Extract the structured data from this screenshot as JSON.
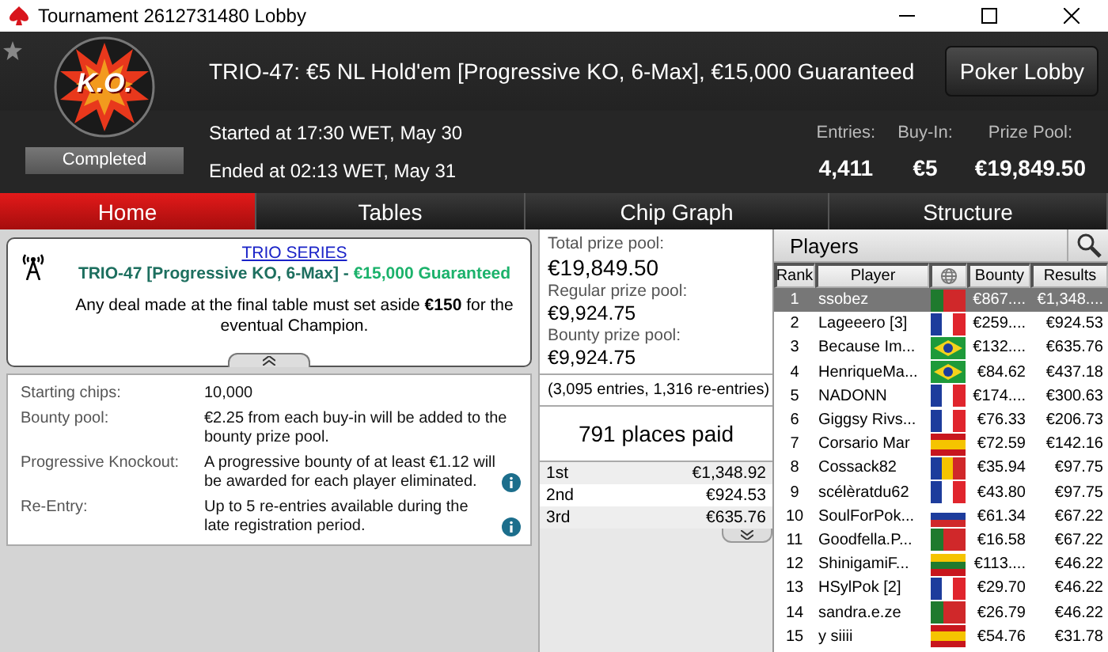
{
  "window": {
    "title": "Tournament 2612731480 Lobby"
  },
  "header": {
    "title": "TRIO-47: €5 NL Hold'em [Progressive KO, 6-Max], €15,000 Guaranteed",
    "status": "Completed",
    "started": "Started at 17:30 WET, May 30",
    "ended": "Ended at 02:13 WET, May 31",
    "lobby_button": "Poker Lobby",
    "logo_text": "K.O.",
    "stats": [
      {
        "label": "Entries:",
        "value": "4,411"
      },
      {
        "label": "Buy-In:",
        "value": "€5"
      },
      {
        "label": "Prize Pool:",
        "value": "€19,849.50"
      }
    ]
  },
  "tabs": [
    {
      "label": "Home",
      "selected": true
    },
    {
      "label": "Tables",
      "selected": false
    },
    {
      "label": "Chip Graph",
      "selected": false
    },
    {
      "label": "Structure",
      "selected": false
    }
  ],
  "info": {
    "series_link": "TRIO SERIES",
    "event": "TRIO-47 [Progressive KO, 6-Max] - ",
    "guarantee": "€15,000 Guaranteed",
    "notice": "Any deal made at the final table must set aside **€150** for the eventual Champion."
  },
  "details": [
    {
      "label": "Starting chips:",
      "value": "10,000",
      "info": false
    },
    {
      "label": "Bounty pool:",
      "value": "€2.25 from each buy-in will be added to the bounty prize pool.",
      "info": false
    },
    {
      "label": "Progressive Knockout:",
      "value": "A progressive bounty of at least €1.12 will be awarded for each player eliminated.",
      "info": true
    },
    {
      "label": "Re-Entry:",
      "value": "Up to 5 re-entries available during the late registration period.",
      "info": true
    }
  ],
  "prize": {
    "pools": [
      {
        "label": "Total prize pool:",
        "value": "€19,849.50"
      },
      {
        "label": "Regular prize pool:",
        "value": "€9,924.75"
      },
      {
        "label": "Bounty prize pool:",
        "value": "€9,924.75"
      }
    ],
    "entries_note": "(3,095 entries, 1,316 re-entries)",
    "places_paid": "791 places paid",
    "payouts": [
      {
        "place": "1st",
        "amount": "€1,348.92"
      },
      {
        "place": "2nd",
        "amount": "€924.53"
      },
      {
        "place": "3rd",
        "amount": "€635.76"
      }
    ]
  },
  "players": {
    "title": "Players",
    "columns": [
      "Rank",
      "Player",
      "Bounty",
      "Results"
    ],
    "rows": [
      {
        "rank": "1",
        "name": "ssobez",
        "kind": "portugal",
        "bounty": "€867....",
        "result": "€1,348....",
        "selected": true
      },
      {
        "rank": "2",
        "name": "Lageeero [3]",
        "kind": "france",
        "bounty": "€259....",
        "result": "€924.53",
        "selected": false
      },
      {
        "rank": "3",
        "name": "Because Im...",
        "kind": "brazil",
        "bounty": "€132....",
        "result": "€635.76",
        "selected": false
      },
      {
        "rank": "4",
        "name": "HenriqueMa...",
        "kind": "brazil",
        "bounty": "€84.62",
        "result": "€437.18",
        "selected": false
      },
      {
        "rank": "5",
        "name": "NADONN",
        "kind": "france",
        "bounty": "€174....",
        "result": "€300.63",
        "selected": false
      },
      {
        "rank": "6",
        "name": "Giggsy Rivs...",
        "kind": "france",
        "bounty": "€76.33",
        "result": "€206.73",
        "selected": false
      },
      {
        "rank": "7",
        "name": "Corsario Mar",
        "kind": "spain",
        "bounty": "€72.59",
        "result": "€142.16",
        "selected": false
      },
      {
        "rank": "8",
        "name": "Cossack82",
        "kind": "moldova",
        "bounty": "€35.94",
        "result": "€97.75",
        "selected": false
      },
      {
        "rank": "9",
        "name": "scélèratdu62",
        "kind": "france",
        "bounty": "€43.80",
        "result": "€97.75",
        "selected": false
      },
      {
        "rank": "10",
        "name": "SoulForPok...",
        "kind": "russia",
        "bounty": "€61.34",
        "result": "€67.22",
        "selected": false
      },
      {
        "rank": "11",
        "name": "Goodfella.P...",
        "kind": "portugal",
        "bounty": "€16.58",
        "result": "€67.22",
        "selected": false
      },
      {
        "rank": "12",
        "name": "ShinigamiF...",
        "kind": "lithuania",
        "bounty": "€113....",
        "result": "€46.22",
        "selected": false
      },
      {
        "rank": "13",
        "name": "HSylPok [2]",
        "kind": "france",
        "bounty": "€29.70",
        "result": "€46.22",
        "selected": false
      },
      {
        "rank": "14",
        "name": "sandra.e.ze",
        "kind": "portugal",
        "bounty": "€26.79",
        "result": "€46.22",
        "selected": false
      },
      {
        "rank": "15",
        "name": "y siiii",
        "kind": "spain",
        "bounty": "€54.76",
        "result": "€31.78",
        "selected": false
      }
    ]
  }
}
